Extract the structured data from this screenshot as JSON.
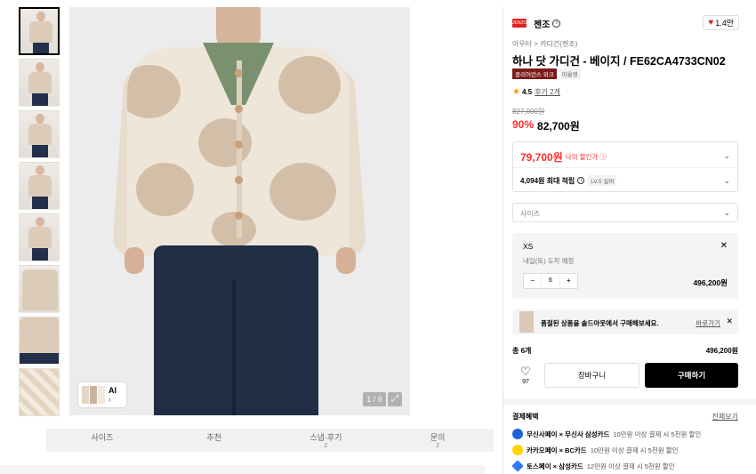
{
  "thumbnails": [
    {
      "label": ""
    },
    {
      "label": ""
    },
    {
      "label": ""
    },
    {
      "label": ""
    },
    {
      "label": ""
    },
    {
      "label": ""
    },
    {
      "label": ""
    },
    {
      "label": ""
    }
  ],
  "gallery": {
    "counter": "1 / 9",
    "ai_label": "AI",
    "ai_arrow": "›"
  },
  "tabs": [
    {
      "label": "사이즈",
      "count": ""
    },
    {
      "label": "추천",
      "count": ""
    },
    {
      "label": "스냅·후기",
      "count": "2"
    },
    {
      "label": "문의",
      "count": "2"
    }
  ],
  "brand": {
    "logo_text": "JENZO",
    "name": "젠조",
    "likes": "1.4만"
  },
  "product": {
    "breadcrumb": "아우터 > 카디건(젠조)",
    "title": "하나 닷 가디건 - 베이지 / FE62CA4733CN02",
    "badge_primary": "클리어런스 위크",
    "badge_secondary": "아울렛",
    "rating": "4.5",
    "reviews": "후기 2개",
    "original_price": "827,000원",
    "discount": "90%",
    "price": "82,700원"
  },
  "my_price": {
    "price": "79,700원",
    "label": "나의 할인가 ⓘ",
    "points": "4,094원 최대 적립",
    "level": "LV.5 실버"
  },
  "size_select": {
    "placeholder": "사이즈"
  },
  "selected_option": {
    "size": "XS",
    "eta": "내일(토) 도착 예정",
    "qty": "6",
    "subtotal": "496,200원"
  },
  "soldout_banner": {
    "text": "품절된 상품을 솔드아웃에서 구매해보세요.",
    "link": "바로가기"
  },
  "total": {
    "label": "총 6개",
    "amount": "496,200원"
  },
  "actions": {
    "wish_count": "97",
    "cart": "장바구니",
    "buy": "구매하기"
  },
  "benefits": {
    "header": "결제혜택",
    "see_all": "전체보기",
    "items": [
      {
        "name": "무신사페이 × 무신사 삼성카드",
        "desc": "10만원 이상 결제 시 5천원 할인",
        "color": "#1e63d6"
      },
      {
        "name": "카카오페이 × BC카드",
        "desc": "10만원 이상 결제 시 5천원 할인",
        "color": "#ffd400"
      },
      {
        "name": "토스페이 × 삼성카드",
        "desc": "12만원 이상 결제 시 5천원 할인",
        "color": "#2b7cf6"
      }
    ]
  }
}
